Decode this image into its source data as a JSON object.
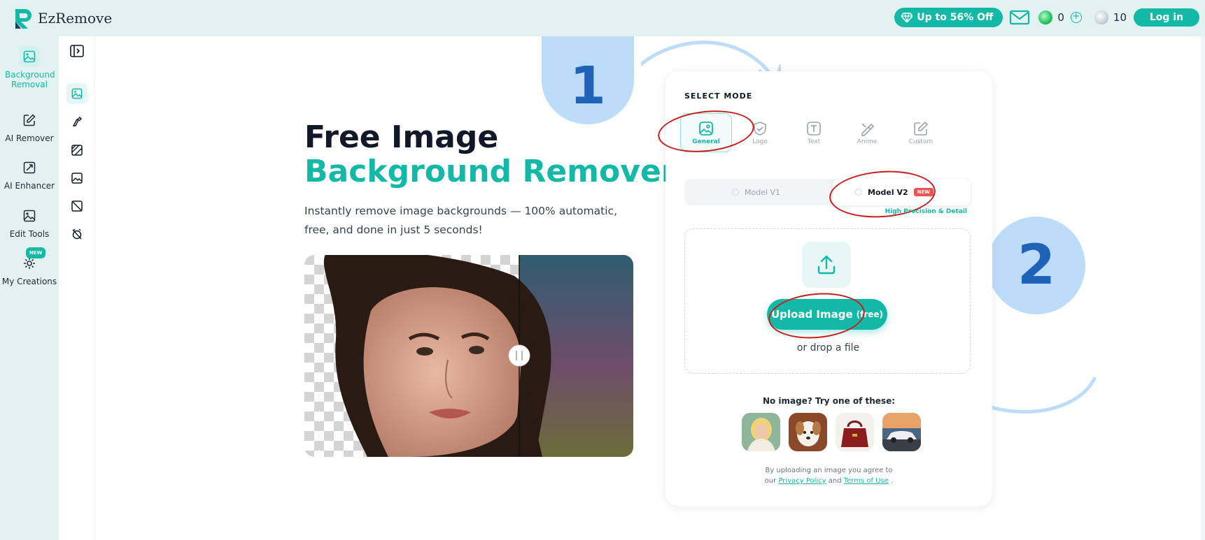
{
  "brand": {
    "name": "EzRemove"
  },
  "topbar": {
    "promo_label": "Up to 56% Off",
    "credits_primary": "0",
    "credits_secondary": "10",
    "login_label": "Log in"
  },
  "leftnav": {
    "items": [
      {
        "label": "Background Removal",
        "icon": "image-icon",
        "active": true
      },
      {
        "label": "AI Remover",
        "icon": "edit-icon"
      },
      {
        "label": "AI Enhancer",
        "icon": "enhance-icon"
      },
      {
        "label": "Edit Tools",
        "icon": "image-edit-icon"
      },
      {
        "label": "My Creations",
        "icon": "sparkle-icon",
        "badge": "NEW"
      }
    ]
  },
  "hero": {
    "title_line1": "Free Image",
    "title_line2": "Background Remover",
    "subtitle": "Instantly remove image backgrounds — 100% automatic, free, and done in just 5 seconds!"
  },
  "annotations": {
    "step1": "1",
    "step2": "2"
  },
  "panel": {
    "select_mode_label": "SELECT MODE",
    "modes": [
      {
        "label": "General",
        "icon": "image-icon",
        "active": true
      },
      {
        "label": "Logo",
        "icon": "shield-icon"
      },
      {
        "label": "Text",
        "icon": "text-icon"
      },
      {
        "label": "Anime",
        "icon": "brush-icon"
      },
      {
        "label": "Custom",
        "icon": "edit-icon"
      }
    ],
    "model_v1": "Model V1",
    "model_v2": "Model V2",
    "model_v2_badge": "NEW",
    "precision_note": "High Precision & Detail",
    "upload_label": "Upload Image",
    "upload_free": "(free)",
    "drop_text": "or drop a file",
    "no_image_label": "No image? Try one of these:",
    "terms_prefix": "By uploading an image you agree to",
    "terms_our": "our",
    "privacy_link": "Privacy Policy",
    "terms_and": "and",
    "terms_link": "Terms of Use",
    "terms_suffix": "."
  },
  "colors": {
    "accent": "#14b8a6",
    "annotation_circle": "#bcdcf8",
    "annotation_ink": "#c81e1e"
  }
}
